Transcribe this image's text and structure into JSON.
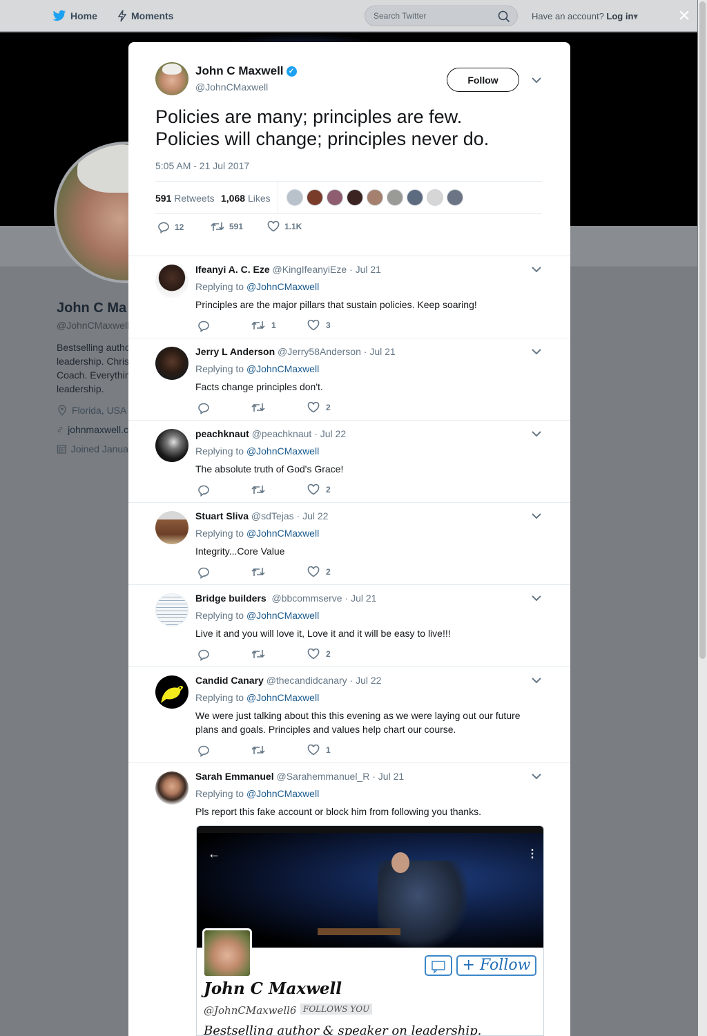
{
  "nav": {
    "home": "Home",
    "moments": "Moments",
    "search_placeholder": "Search Twitter",
    "account_prefix": "Have an account?",
    "login": "Log in",
    "close": "×"
  },
  "background_profile": {
    "name": "John C Ma",
    "handle": "@JohnCMaxwell",
    "bio_lines": [
      "Bestselling autho",
      "leadership. Chris",
      "Coach. Everythin",
      "leadership."
    ],
    "location": "Florida, USA",
    "website": "johnmaxwell.c",
    "joined": "Joined Janua"
  },
  "tweet": {
    "name": "John C Maxwell",
    "handle": "@JohnCMaxwell",
    "follow_label": "Follow",
    "text_line1": "Policies are many; principles are few.",
    "text_line2": "Policies will change; principles never do.",
    "timestamp": "5:05 AM - 21 Jul 2017",
    "retweets_count": "591",
    "retweets_label": "Retweets",
    "likes_count": "1,068",
    "likes_label": "Likes",
    "reply_count": "12",
    "retweet_count": "591",
    "like_count": "1.1K"
  },
  "replies": [
    {
      "name": "Ifeanyi A. C. Eze",
      "handle": "@KingIfeanyiEze",
      "date": "Jul 21",
      "replying_prefix": "Replying to",
      "replying_to": "@JohnCMaxwell",
      "text": "Principles are the major pillars that sustain policies. Keep soaring!",
      "reply_count": "",
      "retweet_count": "1",
      "like_count": "3"
    },
    {
      "name": "Jerry L Anderson",
      "handle": "@Jerry58Anderson",
      "date": "Jul 21",
      "replying_prefix": "Replying to",
      "replying_to": "@JohnCMaxwell",
      "text": "Facts change principles don't.",
      "reply_count": "",
      "retweet_count": "",
      "like_count": "2"
    },
    {
      "name": "peachknaut",
      "handle": "@peachknaut",
      "date": "Jul 22",
      "replying_prefix": "Replying to",
      "replying_to": "@JohnCMaxwell",
      "text": "The absolute truth of God's Grace!",
      "reply_count": "",
      "retweet_count": "",
      "like_count": "2"
    },
    {
      "name": "Stuart Sliva",
      "handle": "@sdTejas",
      "date": "Jul 22",
      "replying_prefix": "Replying to",
      "replying_to": "@JohnCMaxwell",
      "text": "Integrity...Core Value",
      "reply_count": "",
      "retweet_count": "",
      "like_count": "2"
    },
    {
      "name": "Bridge builders",
      "handle": "@bbcommserve",
      "date": "Jul 21",
      "replying_prefix": "Replying to",
      "replying_to": "@JohnCMaxwell",
      "text": "Live it and you will love it, Love it and it will be easy to live!!!",
      "reply_count": "",
      "retweet_count": "",
      "like_count": "2"
    },
    {
      "name": "Candid Canary",
      "handle": "@thecandidcanary",
      "date": "Jul 22",
      "replying_prefix": "Replying to",
      "replying_to": "@JohnCMaxwell",
      "text": "We were just talking about this this evening as we were laying out our future plans and goals. Principles and values help chart our course.",
      "reply_count": "",
      "retweet_count": "",
      "like_count": "1"
    },
    {
      "name": "Sarah Emmanuel",
      "handle": "@Sarahemmanuel_R",
      "date": "Jul 21",
      "replying_prefix": "Replying to",
      "replying_to": "@JohnCMaxwell",
      "text": "Pls report this fake account or block him from following you thanks."
    }
  ],
  "embedded_image": {
    "back_arrow": "←",
    "menu": "⋮",
    "follow_label": "Follow",
    "name": "John C Maxwell",
    "handle": "@JohnCMaxwell6",
    "follows_you": "FOLLOWS YOU",
    "bio": "Bestselling author & speaker on leadership."
  },
  "colors": {
    "twitter_blue": "#1da1f2",
    "overlay": "#7a7d81",
    "muted_text": "#657786",
    "link_blue": "#1b5a8c"
  }
}
